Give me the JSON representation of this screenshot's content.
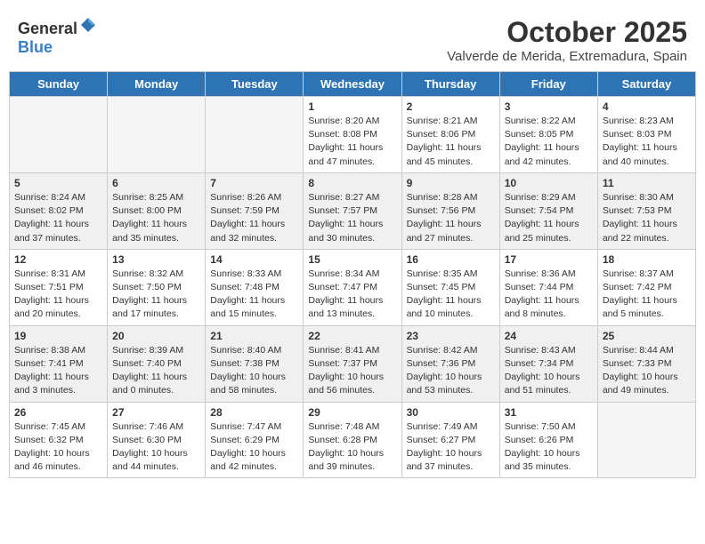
{
  "logo": {
    "general": "General",
    "blue": "Blue"
  },
  "header": {
    "month": "October 2025",
    "location": "Valverde de Merida, Extremadura, Spain"
  },
  "weekdays": [
    "Sunday",
    "Monday",
    "Tuesday",
    "Wednesday",
    "Thursday",
    "Friday",
    "Saturday"
  ],
  "weeks": [
    {
      "shaded": false,
      "days": [
        {
          "num": "",
          "info": ""
        },
        {
          "num": "",
          "info": ""
        },
        {
          "num": "",
          "info": ""
        },
        {
          "num": "1",
          "info": "Sunrise: 8:20 AM\nSunset: 8:08 PM\nDaylight: 11 hours and 47 minutes."
        },
        {
          "num": "2",
          "info": "Sunrise: 8:21 AM\nSunset: 8:06 PM\nDaylight: 11 hours and 45 minutes."
        },
        {
          "num": "3",
          "info": "Sunrise: 8:22 AM\nSunset: 8:05 PM\nDaylight: 11 hours and 42 minutes."
        },
        {
          "num": "4",
          "info": "Sunrise: 8:23 AM\nSunset: 8:03 PM\nDaylight: 11 hours and 40 minutes."
        }
      ]
    },
    {
      "shaded": true,
      "days": [
        {
          "num": "5",
          "info": "Sunrise: 8:24 AM\nSunset: 8:02 PM\nDaylight: 11 hours and 37 minutes."
        },
        {
          "num": "6",
          "info": "Sunrise: 8:25 AM\nSunset: 8:00 PM\nDaylight: 11 hours and 35 minutes."
        },
        {
          "num": "7",
          "info": "Sunrise: 8:26 AM\nSunset: 7:59 PM\nDaylight: 11 hours and 32 minutes."
        },
        {
          "num": "8",
          "info": "Sunrise: 8:27 AM\nSunset: 7:57 PM\nDaylight: 11 hours and 30 minutes."
        },
        {
          "num": "9",
          "info": "Sunrise: 8:28 AM\nSunset: 7:56 PM\nDaylight: 11 hours and 27 minutes."
        },
        {
          "num": "10",
          "info": "Sunrise: 8:29 AM\nSunset: 7:54 PM\nDaylight: 11 hours and 25 minutes."
        },
        {
          "num": "11",
          "info": "Sunrise: 8:30 AM\nSunset: 7:53 PM\nDaylight: 11 hours and 22 minutes."
        }
      ]
    },
    {
      "shaded": false,
      "days": [
        {
          "num": "12",
          "info": "Sunrise: 8:31 AM\nSunset: 7:51 PM\nDaylight: 11 hours and 20 minutes."
        },
        {
          "num": "13",
          "info": "Sunrise: 8:32 AM\nSunset: 7:50 PM\nDaylight: 11 hours and 17 minutes."
        },
        {
          "num": "14",
          "info": "Sunrise: 8:33 AM\nSunset: 7:48 PM\nDaylight: 11 hours and 15 minutes."
        },
        {
          "num": "15",
          "info": "Sunrise: 8:34 AM\nSunset: 7:47 PM\nDaylight: 11 hours and 13 minutes."
        },
        {
          "num": "16",
          "info": "Sunrise: 8:35 AM\nSunset: 7:45 PM\nDaylight: 11 hours and 10 minutes."
        },
        {
          "num": "17",
          "info": "Sunrise: 8:36 AM\nSunset: 7:44 PM\nDaylight: 11 hours and 8 minutes."
        },
        {
          "num": "18",
          "info": "Sunrise: 8:37 AM\nSunset: 7:42 PM\nDaylight: 11 hours and 5 minutes."
        }
      ]
    },
    {
      "shaded": true,
      "days": [
        {
          "num": "19",
          "info": "Sunrise: 8:38 AM\nSunset: 7:41 PM\nDaylight: 11 hours and 3 minutes."
        },
        {
          "num": "20",
          "info": "Sunrise: 8:39 AM\nSunset: 7:40 PM\nDaylight: 11 hours and 0 minutes."
        },
        {
          "num": "21",
          "info": "Sunrise: 8:40 AM\nSunset: 7:38 PM\nDaylight: 10 hours and 58 minutes."
        },
        {
          "num": "22",
          "info": "Sunrise: 8:41 AM\nSunset: 7:37 PM\nDaylight: 10 hours and 56 minutes."
        },
        {
          "num": "23",
          "info": "Sunrise: 8:42 AM\nSunset: 7:36 PM\nDaylight: 10 hours and 53 minutes."
        },
        {
          "num": "24",
          "info": "Sunrise: 8:43 AM\nSunset: 7:34 PM\nDaylight: 10 hours and 51 minutes."
        },
        {
          "num": "25",
          "info": "Sunrise: 8:44 AM\nSunset: 7:33 PM\nDaylight: 10 hours and 49 minutes."
        }
      ]
    },
    {
      "shaded": false,
      "days": [
        {
          "num": "26",
          "info": "Sunrise: 7:45 AM\nSunset: 6:32 PM\nDaylight: 10 hours and 46 minutes."
        },
        {
          "num": "27",
          "info": "Sunrise: 7:46 AM\nSunset: 6:30 PM\nDaylight: 10 hours and 44 minutes."
        },
        {
          "num": "28",
          "info": "Sunrise: 7:47 AM\nSunset: 6:29 PM\nDaylight: 10 hours and 42 minutes."
        },
        {
          "num": "29",
          "info": "Sunrise: 7:48 AM\nSunset: 6:28 PM\nDaylight: 10 hours and 39 minutes."
        },
        {
          "num": "30",
          "info": "Sunrise: 7:49 AM\nSunset: 6:27 PM\nDaylight: 10 hours and 37 minutes."
        },
        {
          "num": "31",
          "info": "Sunrise: 7:50 AM\nSunset: 6:26 PM\nDaylight: 10 hours and 35 minutes."
        },
        {
          "num": "",
          "info": ""
        }
      ]
    }
  ]
}
